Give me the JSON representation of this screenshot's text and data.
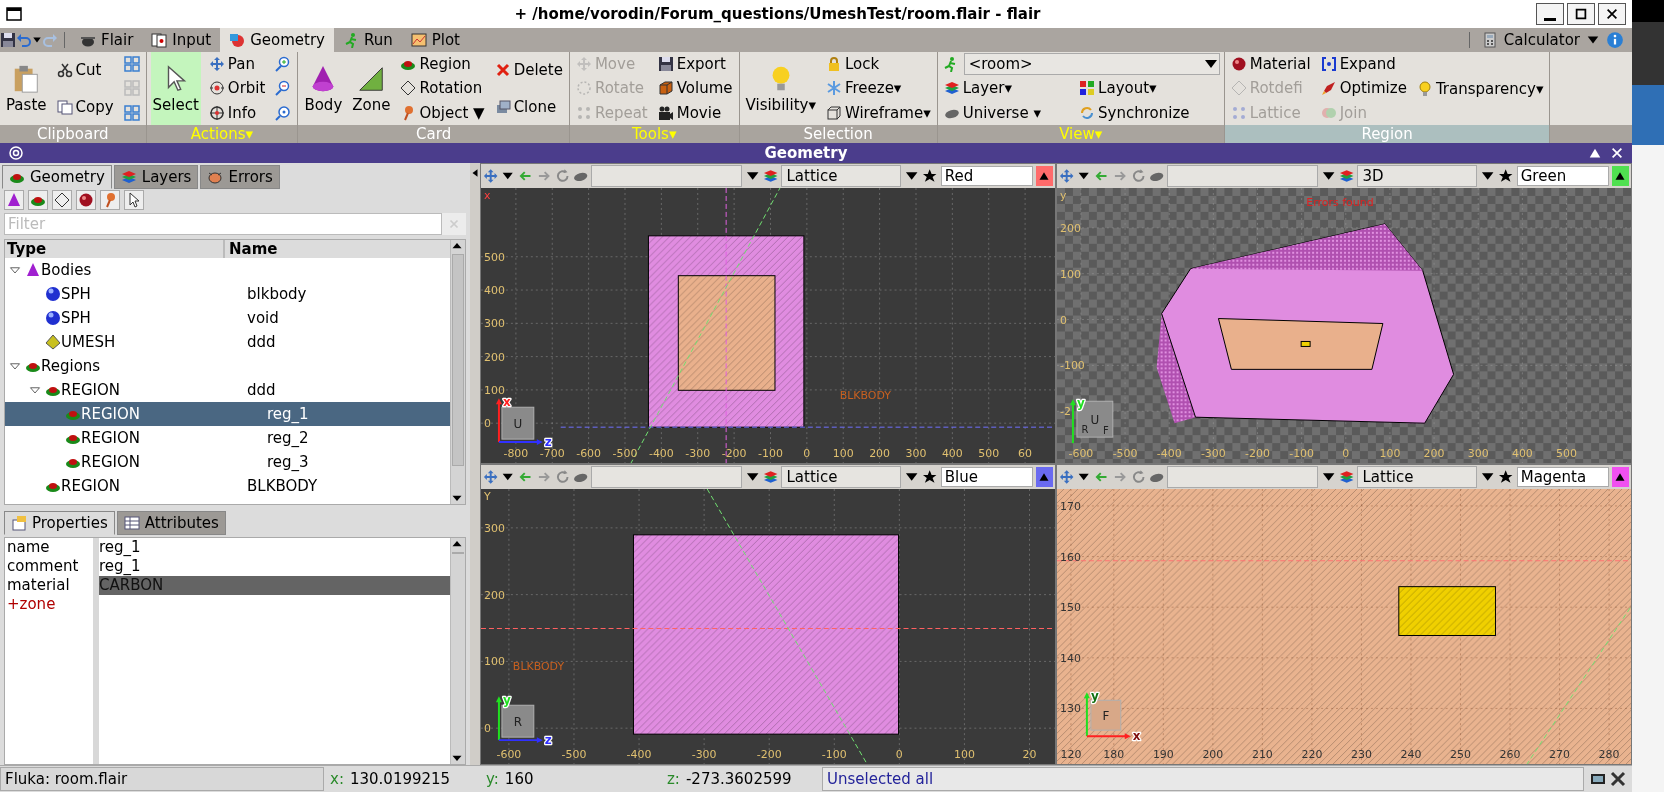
{
  "window": {
    "title": "+ /home/vorodin/Forum_questions/UmeshTest/room.flair - flair"
  },
  "tabs": [
    {
      "label": "Flair",
      "selected": false
    },
    {
      "label": "Input",
      "selected": false
    },
    {
      "label": "Geometry",
      "selected": true
    },
    {
      "label": "Run",
      "selected": false
    },
    {
      "label": "Plot",
      "selected": false
    }
  ],
  "calculator": {
    "label": "Calculator"
  },
  "ribbon": [
    {
      "label": "Clipboard",
      "menu": false,
      "highlighted": false,
      "items": [
        {
          "kind": "big",
          "label": "Paste"
        },
        {
          "kind": "tall",
          "label": "Cut"
        },
        {
          "kind": "tall",
          "label": "Copy"
        },
        {
          "kind": "icon"
        },
        {
          "kind": "icon"
        },
        {
          "kind": "icon"
        }
      ]
    },
    {
      "label": "Actions▾",
      "menu": true,
      "highlighted": false,
      "items": [
        {
          "kind": "big",
          "label": "Select",
          "selected": true
        },
        {
          "kind": "small",
          "label": "Pan",
          "selected": false
        },
        {
          "kind": "small",
          "label": "Orbit",
          "selected": false
        },
        {
          "kind": "small",
          "label": "Info",
          "selected": false
        },
        {
          "kind": "icon",
          "selected": false
        },
        {
          "kind": "icon",
          "selected": false
        },
        {
          "kind": "icon",
          "selected": false
        }
      ]
    },
    {
      "label": "Card",
      "menu": false,
      "highlighted": false,
      "items": [
        {
          "kind": "big",
          "label": "Body"
        },
        {
          "kind": "big",
          "label": "Zone"
        },
        {
          "kind": "small",
          "label": "Region"
        },
        {
          "kind": "small",
          "label": "Rotation"
        },
        {
          "kind": "small",
          "label": "Object ▼"
        },
        {
          "kind": "tall",
          "label": "Delete"
        },
        {
          "kind": "tall",
          "label": "Clone"
        }
      ]
    },
    {
      "label": "Tools▾",
      "menu": true,
      "highlighted": false,
      "items": [
        {
          "kind": "small",
          "label": "Move",
          "disabled": true
        },
        {
          "kind": "small",
          "label": "Rotate",
          "disabled": true
        },
        {
          "kind": "small",
          "label": "Repeat",
          "disabled": true
        },
        {
          "kind": "small",
          "label": "Export",
          "disabled": false
        },
        {
          "kind": "small",
          "label": "Volume",
          "disabled": false
        },
        {
          "kind": "small",
          "label": "Movie",
          "disabled": false
        }
      ]
    },
    {
      "label": "Selection",
      "menu": false,
      "highlighted": false,
      "items": [
        {
          "kind": "big",
          "label": "Visibility▾"
        },
        {
          "kind": "small",
          "label": "Lock"
        },
        {
          "kind": "small",
          "label": "Freeze▾"
        },
        {
          "kind": "small",
          "label": "Wireframe▾"
        }
      ]
    },
    {
      "label": "View▾",
      "menu": true,
      "highlighted": false,
      "items": [
        {
          "kind": "combo",
          "label": "<room>"
        },
        {
          "kind": "small",
          "label": "Layer▾"
        },
        {
          "kind": "small",
          "label": "Universe ▾"
        },
        {
          "kind": "small",
          "label": "Layout▾"
        },
        {
          "kind": "small",
          "label": "Synchronize"
        }
      ]
    },
    {
      "label": "Region",
      "menu": false,
      "highlighted": true,
      "items": [
        {
          "kind": "small",
          "label": "Material",
          "disabled": false
        },
        {
          "kind": "small",
          "label": "Rotdefi",
          "disabled": true
        },
        {
          "kind": "small",
          "label": "Lattice",
          "disabled": true
        },
        {
          "kind": "small",
          "label": "Expand",
          "disabled": false
        },
        {
          "kind": "small",
          "label": "Optimize",
          "disabled": false
        },
        {
          "kind": "small",
          "label": "Join",
          "disabled": true
        },
        {
          "kind": "centered",
          "label": "Transparency▾",
          "disabled": false
        }
      ]
    }
  ],
  "panel": {
    "title": "Geometry"
  },
  "left_panel": {
    "tabs": [
      {
        "label": "Geometry",
        "selected": true
      },
      {
        "label": "Layers",
        "selected": false
      },
      {
        "label": "Errors",
        "selected": false
      }
    ],
    "filter": {
      "placeholder": "Filter"
    },
    "columns": [
      "Type",
      "Name"
    ],
    "tree": [
      {
        "type": "Bodies",
        "kind": "bodies",
        "expanded": true,
        "selected": false,
        "children": [
          {
            "type": "SPH",
            "name": "blkbody",
            "kind": "sphere",
            "selected": false
          },
          {
            "type": "SPH",
            "name": "void",
            "kind": "sphere",
            "selected": false
          },
          {
            "type": "UMESH",
            "name": "ddd",
            "kind": "mesh",
            "selected": false
          }
        ]
      },
      {
        "type": "Regions",
        "kind": "region",
        "expanded": true,
        "selected": false,
        "children": [
          {
            "type": "REGION",
            "name": "ddd",
            "kind": "region",
            "expanded": true,
            "selected": false,
            "children": [
              {
                "type": "REGION",
                "name": "reg_1",
                "kind": "region",
                "selected": true
              },
              {
                "type": "REGION",
                "name": "reg_2",
                "kind": "region",
                "selected": false
              },
              {
                "type": "REGION",
                "name": "reg_3",
                "kind": "region",
                "selected": false
              }
            ]
          },
          {
            "type": "REGION",
            "name": "BLKBODY",
            "kind": "region",
            "selected": false
          }
        ]
      }
    ],
    "property_tabs": [
      {
        "label": "Properties",
        "selected": true
      },
      {
        "label": "Attributes",
        "selected": false
      }
    ],
    "properties": [
      {
        "key": "name",
        "value": "reg_1",
        "kind": "field",
        "selected": false
      },
      {
        "key": "comment",
        "value": "reg_1",
        "kind": "field",
        "selected": false
      },
      {
        "key": "material",
        "value": "CARBON",
        "kind": "field",
        "selected": true
      },
      {
        "key": "+zone",
        "kind": "add",
        "selected": false
      }
    ]
  },
  "viewports": [
    {
      "kind": "slice",
      "projection": "Lattice",
      "color_name": "Red",
      "color": "#ff6b6b",
      "corner_label": "x",
      "body_label": "BLKBODY",
      "cube": [
        "U"
      ],
      "axes": [
        {
          "label": "x",
          "color": "#ff2020"
        },
        {
          "label": "z",
          "color": "#3030ff"
        }
      ],
      "y_ticks": [
        "500",
        "400",
        "300",
        "200",
        "100",
        "0"
      ],
      "x_ticks": [
        "-800",
        "-700",
        "-600",
        "-500",
        "-400",
        "-300",
        "-200",
        "-100",
        "0",
        "100",
        "200",
        "300",
        "400",
        "500",
        "60"
      ]
    },
    {
      "kind": "perspective",
      "projection": "3D",
      "color_name": "Green",
      "color": "#50e050",
      "corner_label": "y",
      "message": "Errors found",
      "cube": [
        "U",
        "R",
        "F"
      ],
      "axes": [
        {
          "label": "y",
          "color": "#20e020"
        }
      ],
      "y_ticks": [
        "200",
        "100",
        "0",
        "-100",
        "-2"
      ],
      "x_ticks": [
        "-600",
        "-500",
        "-400",
        "-300",
        "-200",
        "-100",
        "0",
        "100",
        "200",
        "300",
        "400",
        "500"
      ]
    },
    {
      "kind": "block",
      "projection": "Lattice",
      "color_name": "Blue",
      "color": "#6a6af0",
      "corner_label": "Y",
      "body_label": "BLKBODY",
      "cube": [
        "R"
      ],
      "axes": [
        {
          "label": "y",
          "color": "#20e020"
        },
        {
          "label": "z",
          "color": "#3030ff"
        }
      ],
      "y_ticks": [
        "300",
        "200",
        "100",
        "0"
      ],
      "x_ticks": [
        "-600",
        "-500",
        "-400",
        "-300",
        "-200",
        "-100",
        "0",
        "100",
        "20"
      ]
    },
    {
      "kind": "zoom",
      "projection": "Lattice",
      "color_name": "Magenta",
      "color": "#f050f0",
      "cube": [
        "F"
      ],
      "axes": [
        {
          "label": "y",
          "color": "#20e020"
        },
        {
          "label": "x",
          "color": "#ff2020"
        }
      ],
      "y_ticks": [
        "170",
        "160",
        "150",
        "140",
        "130"
      ],
      "x_ticks": [
        "120",
        "180",
        "190",
        "200",
        "210",
        "220",
        "230",
        "240",
        "250",
        "260",
        "270",
        "280"
      ]
    }
  ],
  "status_bar": {
    "file": "Fluka: room.flair",
    "coords": [
      {
        "axis": "x:",
        "value": "130.0199215"
      },
      {
        "axis": "y:",
        "value": "160"
      },
      {
        "axis": "z:",
        "value": "-273.3602599"
      }
    ],
    "message": "Unselected all"
  }
}
